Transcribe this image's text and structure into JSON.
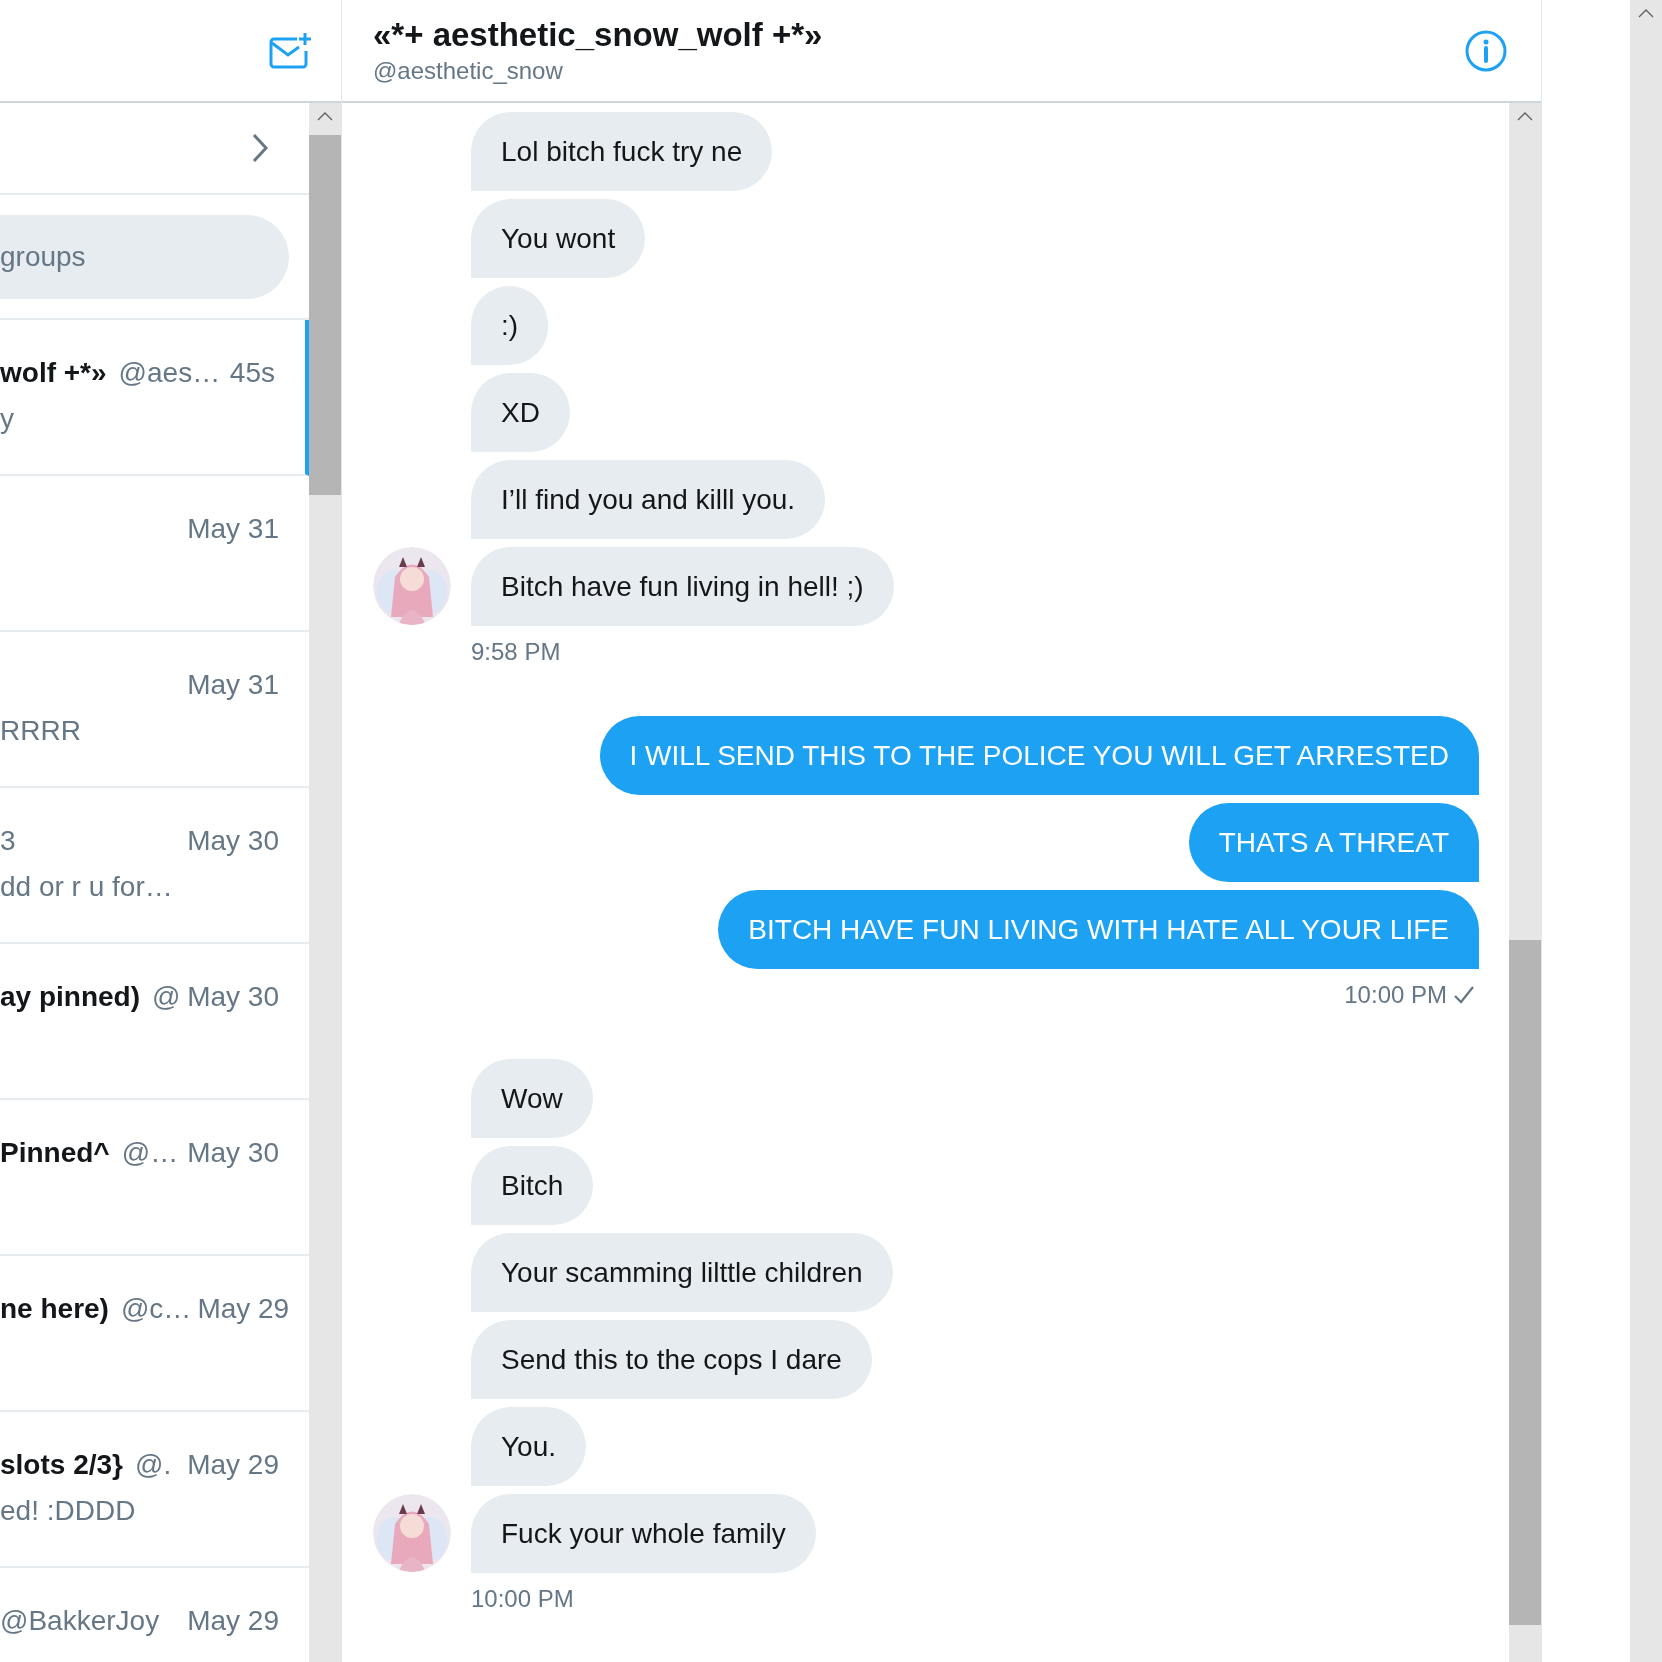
{
  "sidebar": {
    "search": {
      "placeholder": "groups"
    },
    "conversations": [
      {
        "name": "wolf +*»",
        "handle": "@aes…",
        "time": "45s",
        "preview": "y",
        "selected": true
      },
      {
        "time": "May 31",
        "selected": false
      },
      {
        "time": "May 31",
        "preview": "RRRR",
        "selected": false
      },
      {
        "handle": "3",
        "time": "May 30",
        "preview": "dd or r u for…",
        "selected": false
      },
      {
        "name": "ay pinned)",
        "handle": "@",
        "time": "May 30",
        "selected": false
      },
      {
        "name": "Pinned^",
        "handle": "@…",
        "time": "May 30",
        "selected": false
      },
      {
        "name": "ne here)",
        "handle": "@c…",
        "time": "May 29",
        "selected": false
      },
      {
        "name": "slots 2/3}",
        "handle": "@.",
        "time": "May 29",
        "preview": "ed! :DDDD",
        "selected": false
      },
      {
        "handle": "@BakkerJoy",
        "time": "May 29",
        "selected": false
      }
    ]
  },
  "chat": {
    "title": "«*+ aesthetic_snow_wolf +*»",
    "handle": "@aesthetic_snow",
    "groups": [
      {
        "kind": "incoming",
        "messages": [
          "Lol bitch fuck try ne",
          "You wont",
          ":)",
          "XD",
          "I’ll find you and killl you.",
          "Bitch have fun living in hell! ;)"
        ],
        "time": "9:58 PM"
      },
      {
        "kind": "outgoing",
        "messages": [
          "I WILL SEND THIS TO THE POLICE YOU WILL GET ARRESTED",
          "THATS A THREAT",
          "BITCH HAVE FUN LIVING WITH HATE ALL YOUR LIFE"
        ],
        "time": "10:00 PM",
        "read": true
      },
      {
        "kind": "incoming",
        "messages": [
          "Wow",
          "Bitch",
          "Your scamming lilttle children",
          "Send this to the cops I dare",
          "You.",
          "Fuck your whole family"
        ],
        "time": "10:00 PM"
      }
    ]
  }
}
